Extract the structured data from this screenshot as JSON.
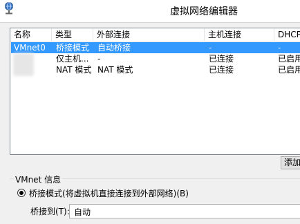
{
  "window": {
    "title": "虚拟网络编辑器"
  },
  "table": {
    "columns": [
      "名称",
      "类型",
      "外部连接",
      "主机连接",
      "DHCP"
    ],
    "rows": [
      {
        "name": "VMnet0",
        "type": "桥接模式",
        "external": "自动桥接",
        "host": "-",
        "dhcp": "-",
        "selected": true
      },
      {
        "name": "",
        "type": "仅主机...",
        "external": "-",
        "host": "已连接",
        "dhcp": "已启用",
        "selected": false
      },
      {
        "name": "",
        "type": "NAT 模式",
        "external": "NAT 模式",
        "host": "已连接",
        "dhcp": "已启用",
        "selected": false
      }
    ]
  },
  "add_button_label": "添加",
  "vmnet_info": {
    "label": "VMnet 信息",
    "bridge_mode_label": "桥接模式(将虚拟机直接连接到外部网络)(B)",
    "bridge_to_label": "桥接到(T):",
    "bridge_to_value": "自动"
  },
  "colors": {
    "selection": "#3399ff"
  },
  "icons": {
    "app": "network-globe-icon"
  }
}
